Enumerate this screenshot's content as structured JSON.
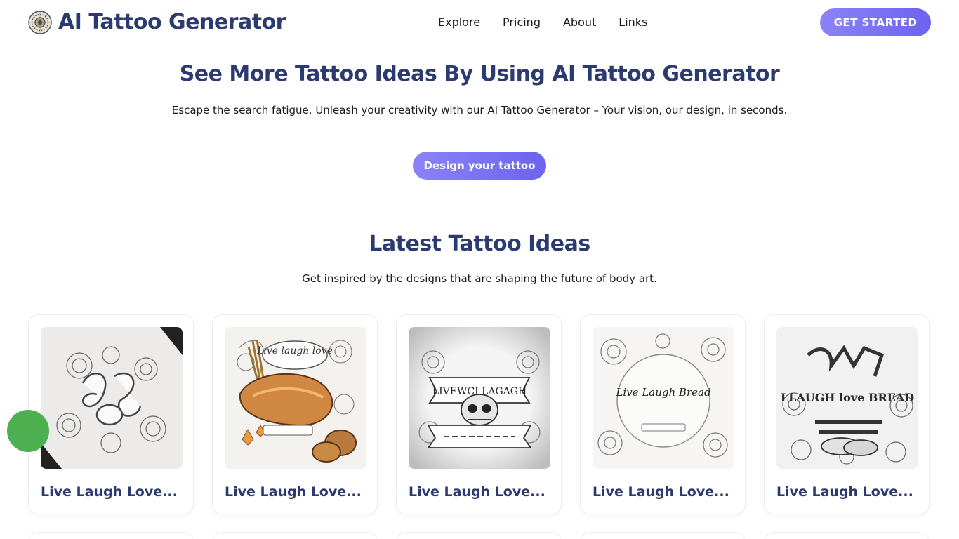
{
  "brand": {
    "name": "AI Tattoo Generator",
    "logo_icon": "mandala-logo-icon"
  },
  "nav": {
    "items": [
      "Explore",
      "Pricing",
      "About",
      "Links"
    ]
  },
  "header": {
    "cta_label": "GET STARTED"
  },
  "hero": {
    "title": "See More Tattoo Ideas By Using AI Tattoo Generator",
    "subtitle": "Escape the search fatigue. Unleash your creativity with our AI Tattoo Generator – Your vision, our design, in seconds.",
    "button_label": "Design your tattoo"
  },
  "latest": {
    "title": "Latest Tattoo Ideas",
    "subtitle": "Get inspired by the designs that are shaping the future of body art.",
    "cards": [
      {
        "title": "Live Laugh Love...",
        "image_text": ""
      },
      {
        "title": "Live Laugh Love...",
        "image_text": "Live laugh love"
      },
      {
        "title": "Live Laugh Love...",
        "image_text": "LIVEWCI LAGAGH"
      },
      {
        "title": "Live Laugh Love...",
        "image_text": "Live Laugh Bread"
      },
      {
        "title": "Live Laugh Love...",
        "image_text": "LLAUGH love BREAD"
      }
    ]
  },
  "colors": {
    "brand_navy": "#2b3a70",
    "button_gradient_start": "#8b83f7",
    "button_gradient_end": "#6c63ef",
    "floating_widget": "#4caf50"
  }
}
